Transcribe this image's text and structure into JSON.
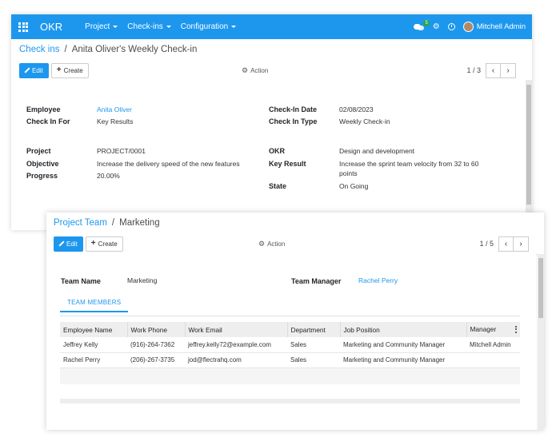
{
  "navbar": {
    "brand": "OKR",
    "menus": [
      "Project",
      "Check-ins",
      "Configuration"
    ],
    "chat_badge": "5",
    "user_name": "Mitchell Admin"
  },
  "checkin": {
    "breadcrumb_parent": "Check ins",
    "breadcrumb_current": "Anita Oliver's Weekly Check-in",
    "edit_label": "Edit",
    "create_label": "Create",
    "action_label": "Action",
    "pager": "1 / 3",
    "fields": {
      "employee_label": "Employee",
      "employee_value": "Anita Oliver",
      "check_in_for_label": "Check In For",
      "check_in_for_value": "Key Results",
      "project_label": "Project",
      "project_value": "PROJECT/0001",
      "objective_label": "Objective",
      "objective_value": "Increase the delivery speed of the new features",
      "progress_label": "Progress",
      "progress_value": "20.00%",
      "date_label": "Check-In Date",
      "date_value": "02/08/2023",
      "type_label": "Check In Type",
      "type_value": "Weekly Check-in",
      "okr_label": "OKR",
      "okr_value": "Design and development",
      "key_result_label": "Key Result",
      "key_result_line1": "Increase the sprint team velocity from 32 to 60",
      "key_result_line2": "points",
      "state_label": "State",
      "state_value": "On Going"
    }
  },
  "team": {
    "breadcrumb_parent": "Project Team",
    "breadcrumb_current": "Marketing",
    "edit_label": "Edit",
    "create_label": "Create",
    "action_label": "Action",
    "pager": "1 / 5",
    "team_name_label": "Team Name",
    "team_name_value": "Marketing",
    "team_manager_label": "Team Manager",
    "team_manager_value": "Rachel Perry",
    "tab_label": "TEAM MEMBERS",
    "columns": [
      "Employee Name",
      "Work Phone",
      "Work Email",
      "Department",
      "Job Position",
      "Manager"
    ],
    "rows": [
      [
        "Jeffrey Kelly",
        "(916)-264-7362",
        "jeffrey.kelly72@example.com",
        "Sales",
        "Marketing and Community Manager",
        "Mitchell Admin"
      ],
      [
        "Rachel Perry",
        "(206)-267-3735",
        "jod@flectrahq.com",
        "Sales",
        "Marketing and Community Manager",
        ""
      ]
    ]
  },
  "colors": {
    "primary": "#1d97ee",
    "badge": "#28a745"
  }
}
